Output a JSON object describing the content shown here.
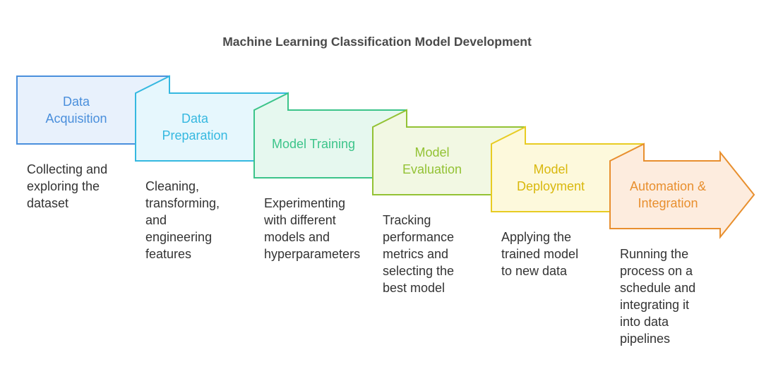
{
  "title": "Machine Learning Classification Model Development",
  "steps": [
    {
      "label": "Data\nAcquisition",
      "description": "Collecting and\nexploring the\ndataset",
      "stroke": "#4a8fdc",
      "fill": "#e8f1fc",
      "text_color": "#4a8fdc"
    },
    {
      "label": "Data\nPreparation",
      "description": "Cleaning,\ntransforming,\nand\nengineering\nfeatures",
      "stroke": "#35b8e0",
      "fill": "#e6f7fd",
      "text_color": "#35b8e0"
    },
    {
      "label": "Model Training",
      "description": "Experimenting\nwith different\nmodels and\nhyperparameters",
      "stroke": "#3cc48a",
      "fill": "#e6f8ef",
      "text_color": "#3cc48a"
    },
    {
      "label": "Model\nEvaluation",
      "description": "Tracking\nperformance\nmetrics and\nselecting the\nbest model",
      "stroke": "#93c234",
      "fill": "#f2f8e3",
      "text_color": "#93c234"
    },
    {
      "label": "Model\nDeployment",
      "description": "Applying the\ntrained model\nto new data",
      "stroke": "#e8cc22",
      "fill": "#fdf9dc",
      "text_color": "#d9b80d"
    },
    {
      "label": "Automation &\nIntegration",
      "description": "Running the\nprocess on a\nschedule and\nintegrating it\ninto data\npipelines",
      "stroke": "#e88f2e",
      "fill": "#fdecde",
      "text_color": "#e88f2e"
    }
  ]
}
